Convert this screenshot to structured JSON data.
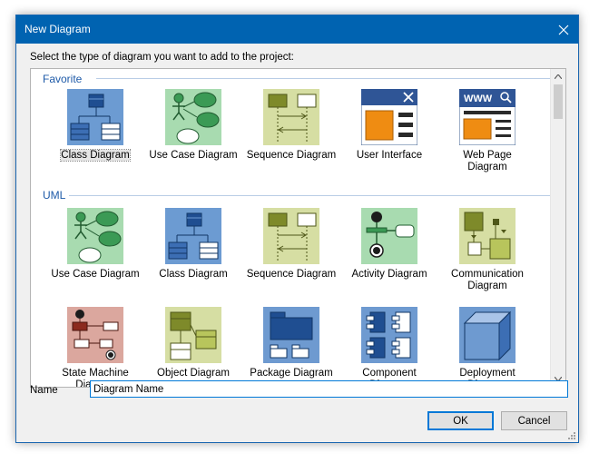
{
  "dialog": {
    "title": "New Diagram",
    "prompt": "Select the type of diagram you want to add to the project:",
    "groups": {
      "favorite": {
        "header": "Favorite",
        "items": [
          "Class Diagram",
          "Use Case Diagram",
          "Sequence Diagram",
          "User Interface",
          "Web Page Diagram"
        ]
      },
      "uml": {
        "header": "UML",
        "items": [
          "Use Case Diagram",
          "Class Diagram",
          "Sequence Diagram",
          "Activity Diagram",
          "Communication Diagram",
          "State Machine Diagram",
          "Object Diagram",
          "Package Diagram",
          "Component Diagram",
          "Deployment Diagram"
        ]
      }
    },
    "name_label": "Name",
    "name_value": "Diagram Name",
    "ok_label": "OK",
    "cancel_label": "Cancel",
    "selected_item": "Class Diagram",
    "colors": {
      "titlebar": "#0063b1",
      "group_header": "#1e5aa8",
      "class_tile": "#6c9bd2",
      "usecase_tile": "#a8dbb0",
      "sequence_tile": "#d6dea3",
      "state_tile": "#dba79e",
      "package_tile": "#6e9ad0"
    }
  }
}
